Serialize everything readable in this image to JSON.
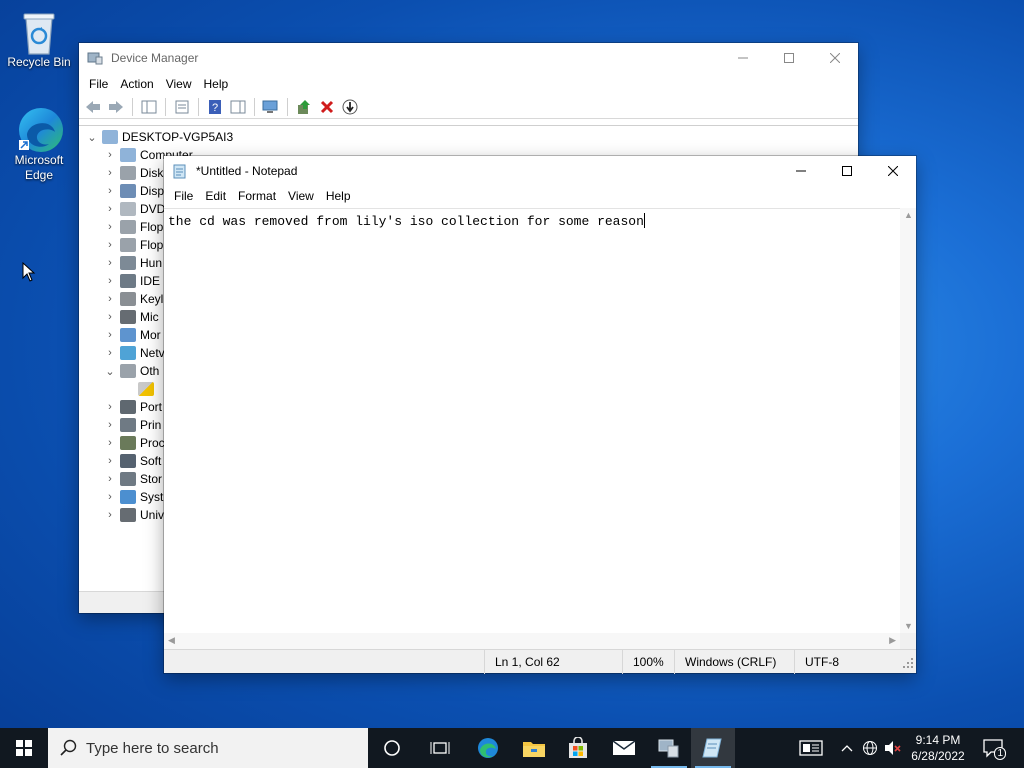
{
  "desktop": {
    "icons": [
      {
        "label": "Recycle Bin"
      },
      {
        "label": "Microsoft Edge",
        "line1": "Microsoft",
        "line2": "Edge"
      }
    ]
  },
  "device_manager": {
    "title": "Device Manager",
    "menu": [
      "File",
      "Action",
      "View",
      "Help"
    ],
    "root": "DESKTOP-VGP5AI3",
    "tree": [
      {
        "label": "Computer",
        "expanded": false
      },
      {
        "label": "Disk",
        "expanded": false
      },
      {
        "label": "Disp",
        "expanded": false
      },
      {
        "label": "DVD",
        "expanded": false
      },
      {
        "label": "Flop",
        "expanded": false
      },
      {
        "label": "Flop",
        "expanded": false
      },
      {
        "label": "Hun",
        "expanded": false
      },
      {
        "label": "IDE",
        "expanded": false
      },
      {
        "label": "Keyl",
        "expanded": false
      },
      {
        "label": "Mic",
        "expanded": false
      },
      {
        "label": "Mor",
        "expanded": false
      },
      {
        "label": "Netv",
        "expanded": false
      },
      {
        "label": "Oth",
        "expanded": true
      },
      {
        "label": "",
        "child": true
      },
      {
        "label": "Port",
        "expanded": false
      },
      {
        "label": "Prin",
        "expanded": false
      },
      {
        "label": "Proc",
        "expanded": false
      },
      {
        "label": "Soft",
        "expanded": false
      },
      {
        "label": "Stor",
        "expanded": false
      },
      {
        "label": "Syst",
        "expanded": false
      },
      {
        "label": "Univ",
        "expanded": false
      }
    ]
  },
  "notepad": {
    "title": "*Untitled - Notepad",
    "menu": [
      "File",
      "Edit",
      "Format",
      "View",
      "Help"
    ],
    "text": "the cd was removed from lily's iso collection for some reason",
    "status": {
      "position": "Ln 1, Col 62",
      "zoom": "100%",
      "line_ending": "Windows (CRLF)",
      "encoding": "UTF-8"
    }
  },
  "taskbar": {
    "search_placeholder": "Type here to search",
    "time": "9:14 PM",
    "date": "6/28/2022",
    "notification_count": "1"
  }
}
